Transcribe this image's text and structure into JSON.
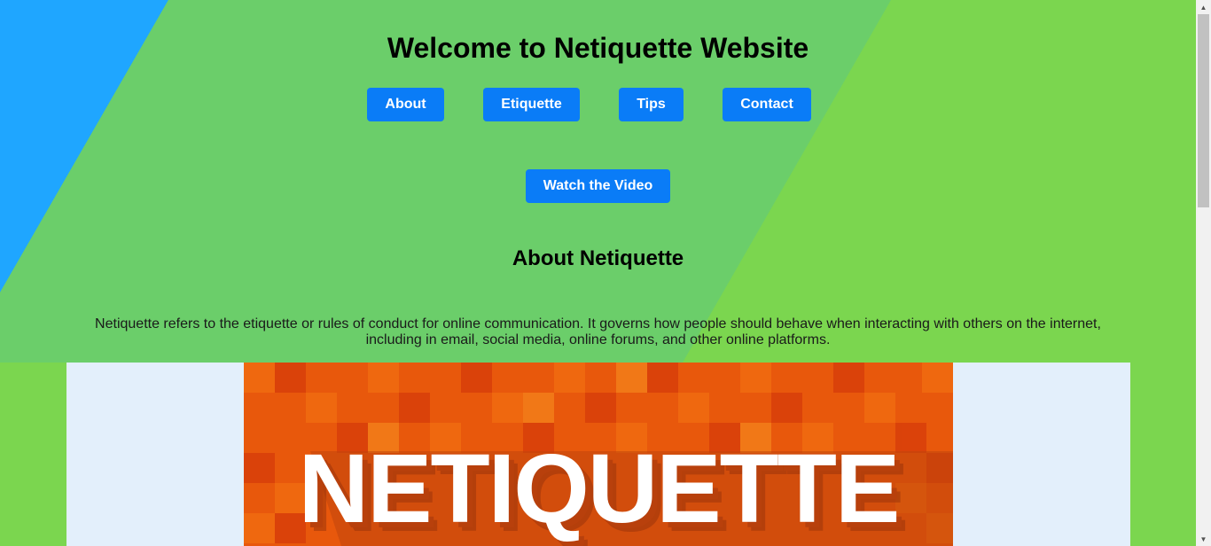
{
  "header": {
    "title": "Welcome to Netiquette Website"
  },
  "nav": [
    {
      "label": "About"
    },
    {
      "label": "Etiquette"
    },
    {
      "label": "Tips"
    },
    {
      "label": "Contact"
    }
  ],
  "video_button": {
    "label": "Watch the Video"
  },
  "about": {
    "heading": "About Netiquette",
    "text": "Netiquette refers to the etiquette or rules of conduct for online communication. It governs how people should behave when interacting with others on the internet, including in email, social media, online forums, and other online platforms."
  },
  "banner": {
    "text": "NETIQUETTE",
    "background": "#e8580c"
  },
  "colors": {
    "button": "#0a7cf7",
    "background_green": "#7bd64f",
    "band_green": "#6bce6a",
    "corner_blue": "#1fa6ff"
  },
  "scrollbar": {
    "up_icon": "arrow-up-icon",
    "down_icon": "arrow-down-icon"
  }
}
